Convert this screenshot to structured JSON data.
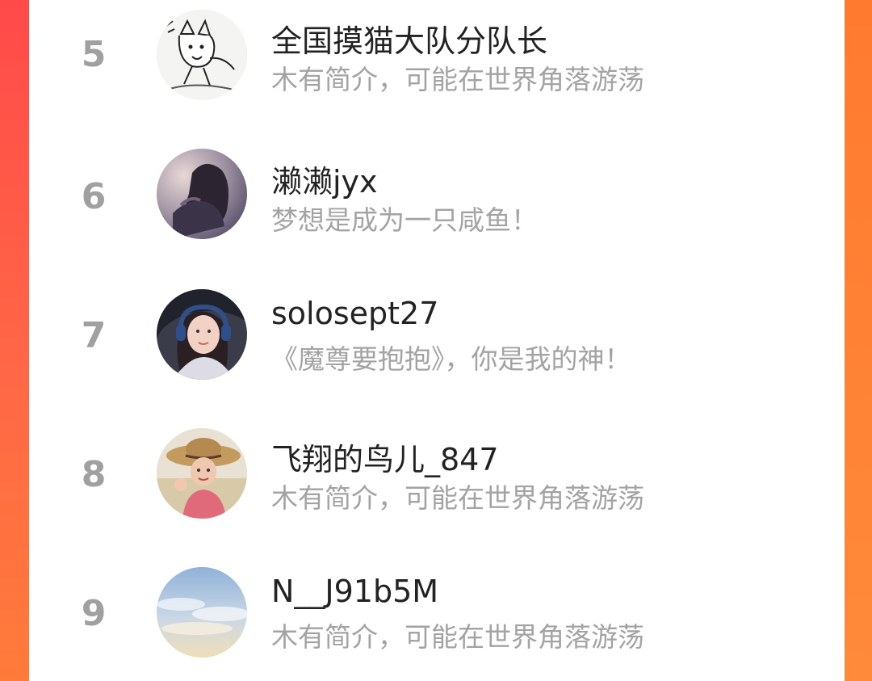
{
  "theme": {
    "accent": "#ff4a4a",
    "accent_alt": "#ff7b3a",
    "rank_color": "#a0a0a0",
    "name_color": "#222222",
    "bio_color": "#a3a3a3"
  },
  "leaderboard": {
    "rows": [
      {
        "rank": "5",
        "name": "全国摸猫大队分队长",
        "bio": "木有简介，可能在世界角落游荡",
        "avatar": "cartoon-cat-sketch-avatar"
      },
      {
        "rank": "6",
        "name": "濑濑jyx",
        "bio": "梦想是成为一只咸鱼！",
        "avatar": "woman-silhouette-avatar"
      },
      {
        "rank": "7",
        "name": "solosept27",
        "bio": "《魔尊要抱抱》，你是我的神！",
        "avatar": "girl-headphones-avatar"
      },
      {
        "rank": "8",
        "name": "飞翔的鸟儿_847",
        "bio": "木有简介，可能在世界角落游荡",
        "avatar": "child-straw-hat-avatar"
      },
      {
        "rank": "9",
        "name": "N__J91b5M",
        "bio": "木有简介，可能在世界角落游荡",
        "avatar": "sky-clouds-avatar"
      }
    ]
  }
}
